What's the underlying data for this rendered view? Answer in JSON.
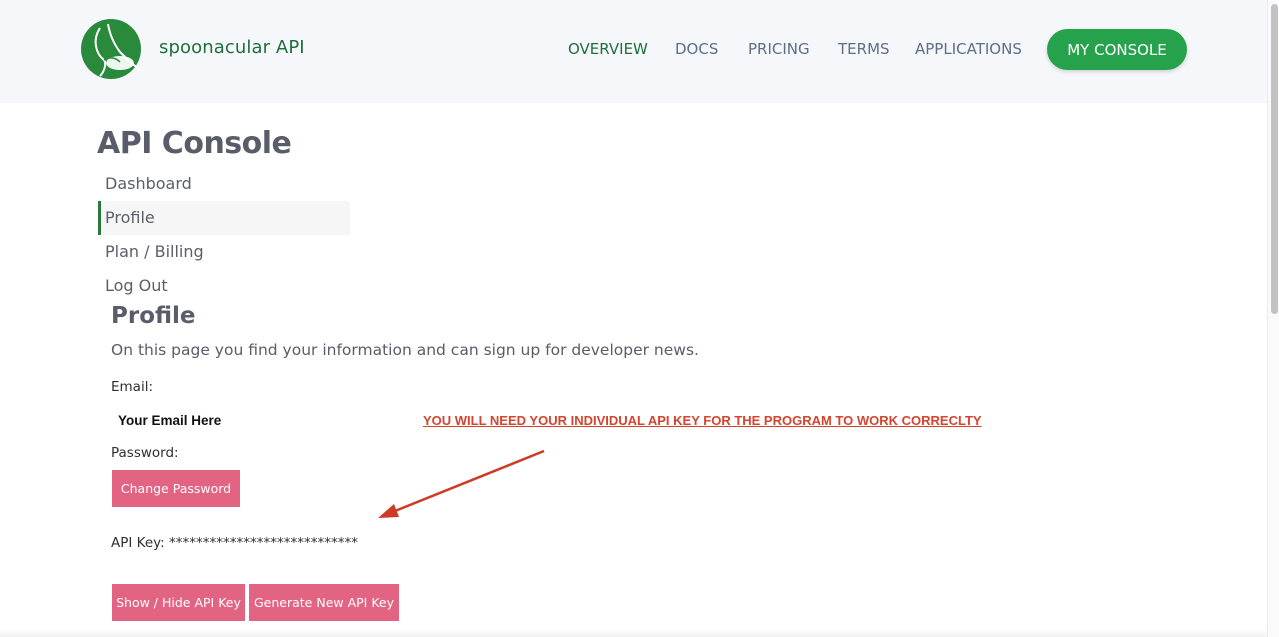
{
  "header": {
    "brand": "spoonacular API",
    "nav": [
      "OVERVIEW",
      "DOCS",
      "PRICING",
      "TERMS",
      "APPLICATIONS"
    ],
    "console_button": "MY CONSOLE",
    "accent_color": "#26a24c"
  },
  "page_title": "API Console",
  "sidebar": {
    "items": [
      "Dashboard",
      "Profile",
      "Plan / Billing",
      "Log Out"
    ],
    "selected": "Profile"
  },
  "profile": {
    "title": "Profile",
    "intro": "On this page you find your information and can sign up for developer news.",
    "email_label": "Email:",
    "email_value": "Your Email Here",
    "warning": "YOU WILL NEED YOUR INDIVIDUAL API KEY FOR THE PROGRAM TO WORK CORRECLTY",
    "password_label": "Password:",
    "change_password": "Change Password",
    "api_key": "API Key: ****************************",
    "show_hide": "Show / Hide API Key",
    "generate": "Generate New API Key"
  }
}
